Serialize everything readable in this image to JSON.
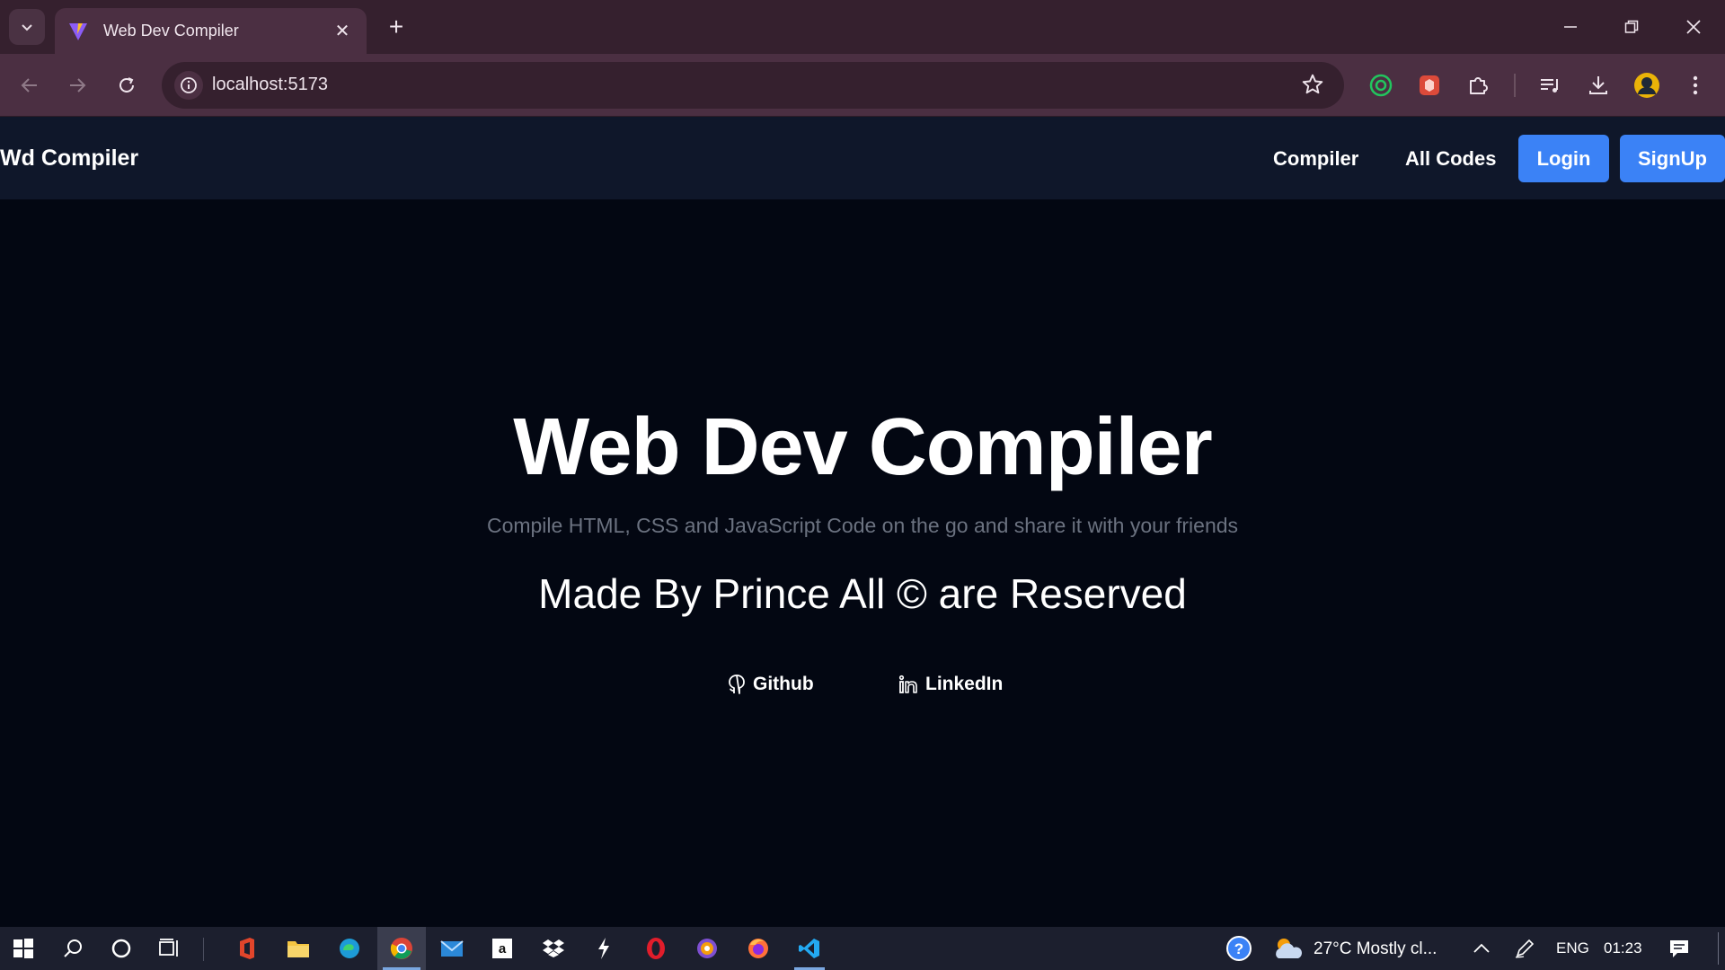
{
  "browser": {
    "tab": {
      "title": "Web Dev Compiler"
    },
    "omnibox": {
      "url": "localhost:5173"
    }
  },
  "site": {
    "brand": "Wd Compiler",
    "nav": {
      "compiler": "Compiler",
      "all_codes": "All Codes",
      "login": "Login",
      "signup": "SignUp"
    },
    "hero": {
      "title": "Web Dev Compiler",
      "subtitle": "Compile HTML, CSS and JavaScript Code on the go and share it with your friends",
      "made_by": "Made By Prince All © are Reserved",
      "github": "Github",
      "linkedin": "LinkedIn"
    }
  },
  "taskbar": {
    "weather": "27°C  Mostly cl...",
    "language": "ENG",
    "time": "01:23"
  },
  "colors": {
    "page_bg": "#030712",
    "nav_bg": "#0f172a",
    "button_blue": "#3b82f6",
    "subtitle_gray": "#6b7280",
    "browser_frame": "#4b2f42"
  }
}
